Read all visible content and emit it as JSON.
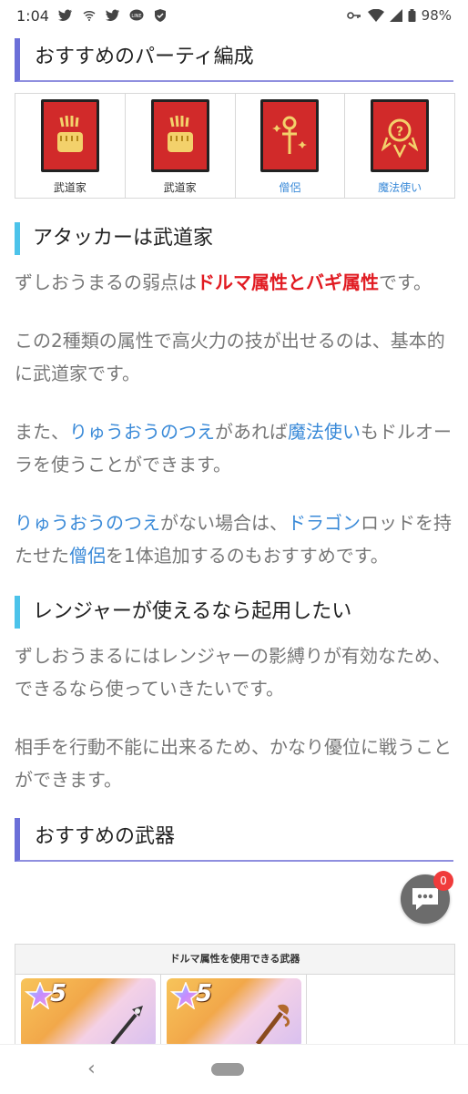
{
  "status_bar": {
    "time": "1:04",
    "battery": "98%",
    "left_icons": [
      "twitter-icon",
      "wifi-calling-icon",
      "twitter-icon",
      "line-icon",
      "shield-icon"
    ],
    "right_icons": [
      "key-icon",
      "wifi-icon",
      "signal-icon",
      "battery-icon"
    ]
  },
  "section_party": {
    "title": "おすすめのパーティ編成",
    "members": [
      {
        "label": "武道家",
        "icon": "martial-artist-fist-icon",
        "is_link": false
      },
      {
        "label": "武道家",
        "icon": "martial-artist-fist-icon",
        "is_link": false
      },
      {
        "label": "僧侶",
        "icon": "priest-staff-icon",
        "is_link": true
      },
      {
        "label": "魔法使い",
        "icon": "mage-emblem-icon",
        "is_link": true
      }
    ]
  },
  "section_attacker": {
    "title": "アタッカーは武道家",
    "p1": {
      "a": "ずしおうまるの弱点は",
      "b": "ドルマ属性とバギ属性",
      "c": "です。"
    },
    "p2": "この2種類の属性で高火力の技が出せるのは、基本的に武道家です。",
    "p3": {
      "a": "また、",
      "b": "りゅうおうのつえ",
      "c": "があれば",
      "d": "魔法使い",
      "e": "もドルオーラを使うことができます。"
    },
    "p4": {
      "a": "りゅうおうのつえ",
      "b": "がない場合は、",
      "c": "ドラゴン",
      "d": "ロッドを持たせた",
      "e": "僧侶",
      "f": "を1体追加するのもおすすめです。"
    }
  },
  "section_ranger": {
    "title": "レンジャーが使えるなら起用したい",
    "p1": "ずしおうまるにはレンジャーの影縛りが有効なため、できるなら使っていきたいです。",
    "p2": "相手を行動不能に出来るため、かなり優位に戦うことができます。"
  },
  "section_weapons": {
    "title": "おすすめの武器",
    "table_header": "ドルマ属性を使用できる武器",
    "cards": [
      {
        "rarity": "5",
        "icon": "staff-weapon-icon"
      },
      {
        "rarity": "5",
        "icon": "rod-weapon-icon"
      }
    ]
  },
  "chat_fab": {
    "badge": "0"
  },
  "colors": {
    "heading_purple": "#6b6fd8",
    "heading_cyan": "#4cc3ea",
    "emphasis_red": "#e11b22",
    "link_blue": "#3a8ad8",
    "icon_red": "#d12a2a"
  }
}
